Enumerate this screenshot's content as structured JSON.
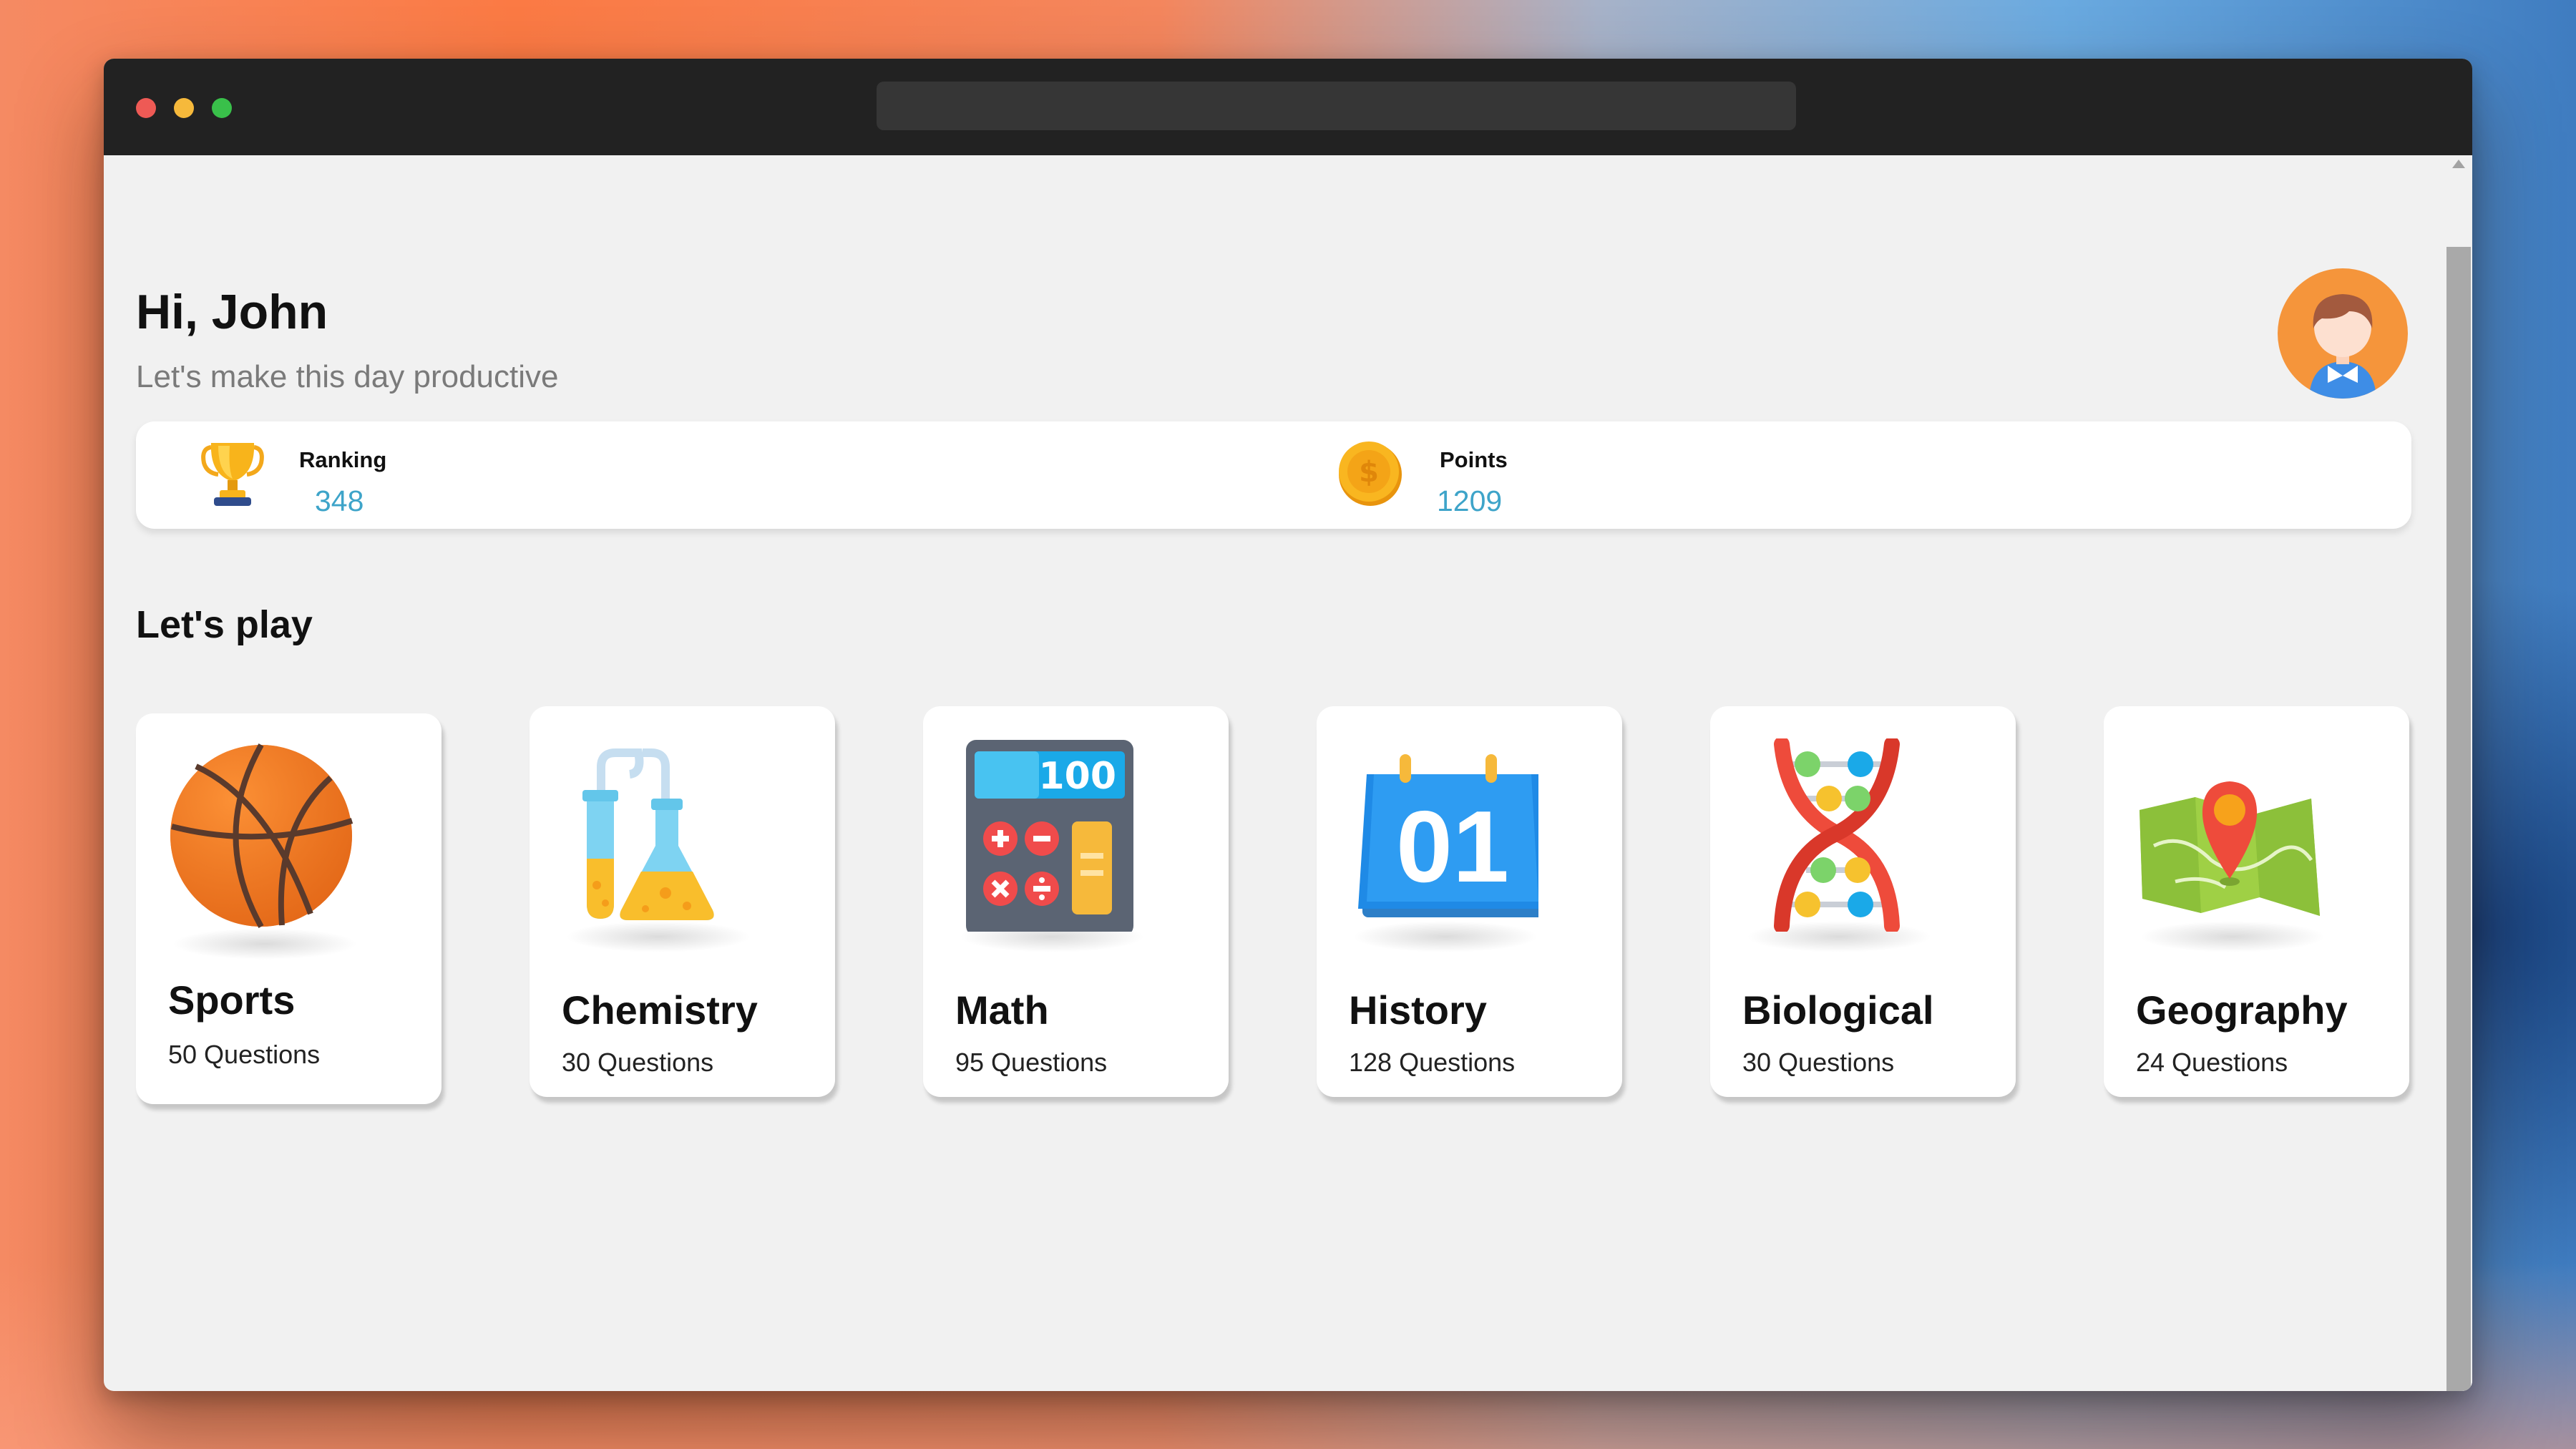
{
  "colors": {
    "window_bg": "#f1f1f1",
    "titlebar": "#222222",
    "accent_value": "#3ea4c9",
    "avatar_bg": "#f5953b"
  },
  "header": {
    "greeting": "Hi, John",
    "subtitle": "Let's make this day productive",
    "avatar_icon": "user-avatar"
  },
  "stats": [
    {
      "label": "Ranking",
      "value": "348",
      "icon": "trophy-icon"
    },
    {
      "label": "Points",
      "value": "1209",
      "icon": "coin-icon"
    }
  ],
  "section_title": "Let's play",
  "categories": [
    {
      "title": "Sports",
      "subtitle": "50 Questions",
      "icon": "basketball-icon"
    },
    {
      "title": "Chemistry",
      "subtitle": "30 Questions",
      "icon": "flask-icon"
    },
    {
      "title": "Math",
      "subtitle": "95 Questions",
      "icon": "calculator-icon",
      "display": "100"
    },
    {
      "title": "History",
      "subtitle": "128 Questions",
      "icon": "calendar-icon",
      "display": "01"
    },
    {
      "title": "Biological",
      "subtitle": "30 Questions",
      "icon": "dna-icon"
    },
    {
      "title": "Geography",
      "subtitle": "24 Questions",
      "icon": "map-icon"
    }
  ]
}
